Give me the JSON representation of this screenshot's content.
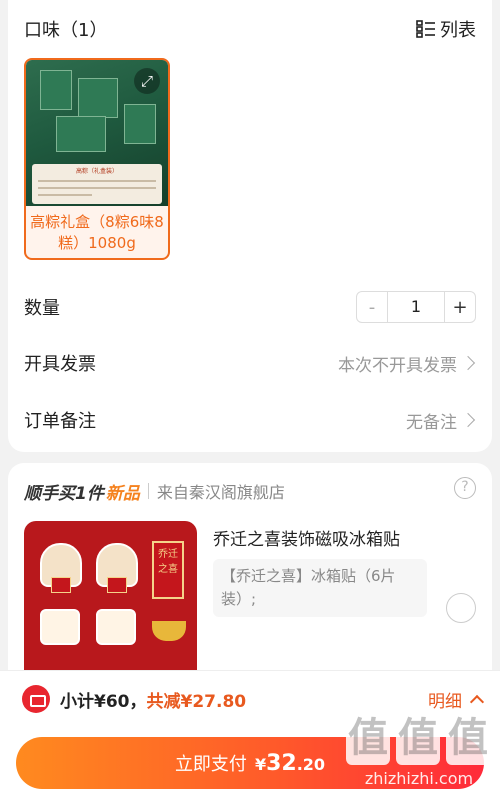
{
  "flavor": {
    "title": "口味（1）",
    "list_label": "列表"
  },
  "product": {
    "name": "高粽礼盒（8粽6味8糕）1080g",
    "image_band_title": "高粽（礼盒装）"
  },
  "quantity": {
    "label": "数量",
    "minus": "-",
    "value": "1",
    "plus": "+"
  },
  "invoice": {
    "label": "开具发票",
    "value": "本次不开具发票"
  },
  "remark": {
    "label": "订单备注",
    "value": "无备注"
  },
  "promo": {
    "heading_a": "顺手买1件",
    "heading_b": "新品",
    "shop": "来自秦汉阁旗舰店",
    "help": "?",
    "item_title": "乔迁之喜装饰磁吸冰箱贴",
    "item_desc": "【乔迁之喜】冰箱贴（6片装）;",
    "seal_text": "乔迁之喜"
  },
  "summary": {
    "subtotal": "小计¥60，",
    "discount": "共减¥27.80",
    "detail": "明细"
  },
  "pay": {
    "label": "立即支付",
    "currency": "¥",
    "amount_int": "32",
    "amount_dec": ".20"
  },
  "watermark": {
    "text": "zhizhizhi.com",
    "glyph": "值"
  },
  "colors": {
    "accent": "#f06a1c",
    "pay_start": "#ff8a1f",
    "pay_end": "#ff2a3a",
    "coupon": "#e8262f"
  }
}
